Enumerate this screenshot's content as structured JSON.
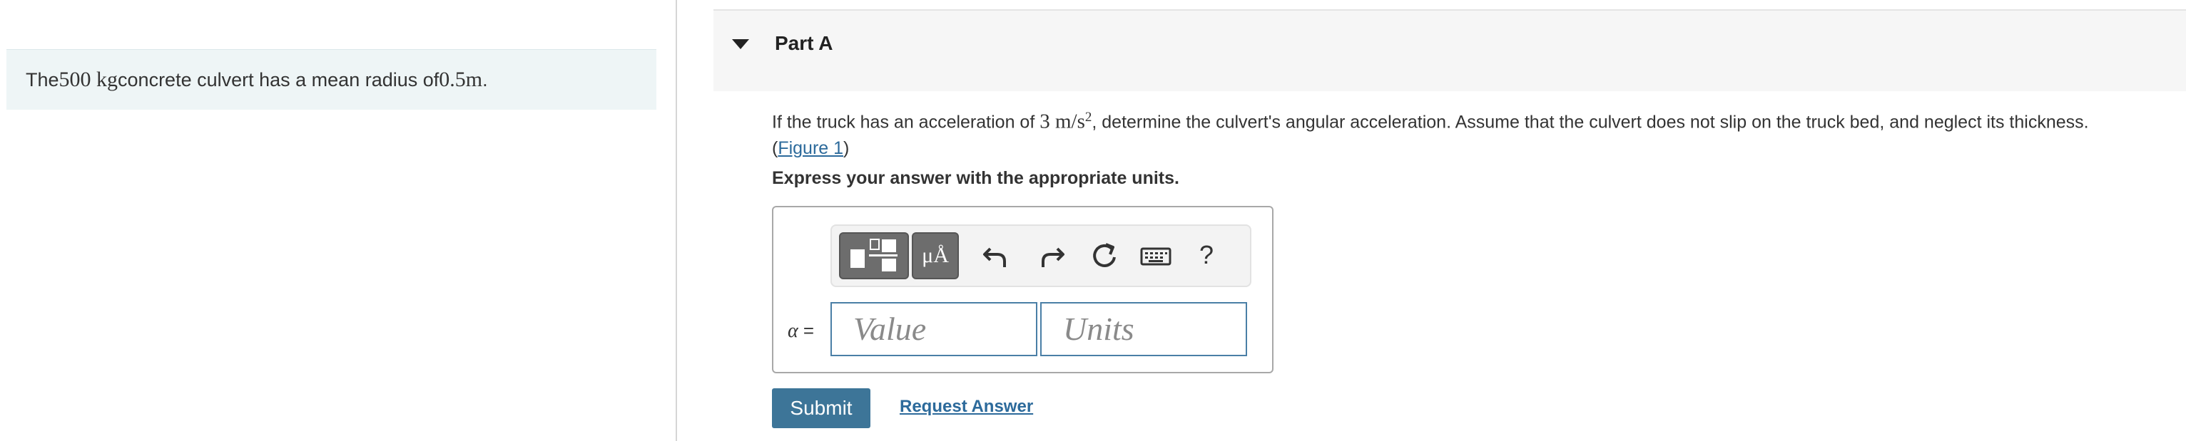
{
  "problem": {
    "prefix": "The ",
    "mass": "500 kg",
    "middle": " concrete culvert has a mean radius of ",
    "radius": "0.5m",
    "suffix": "."
  },
  "part": {
    "title": "Part A",
    "question_prefix": "If the truck has an acceleration of ",
    "acceleration": "3 m/s",
    "acceleration_exp": "2",
    "question_suffix": ", determine the culvert's angular acceleration. Assume that the culvert does not slip on the truck bed, and neglect its thickness.",
    "figure_open": "(",
    "figure_link": "Figure 1",
    "figure_close": ")",
    "instruction": "Express your answer with the appropriate units."
  },
  "answer": {
    "symbol": "α",
    "equals": " =",
    "value_placeholder": "Value",
    "units_placeholder": "Units",
    "symbols_button": "μÅ",
    "help": "?"
  },
  "actions": {
    "submit": "Submit",
    "request_answer": "Request Answer"
  }
}
